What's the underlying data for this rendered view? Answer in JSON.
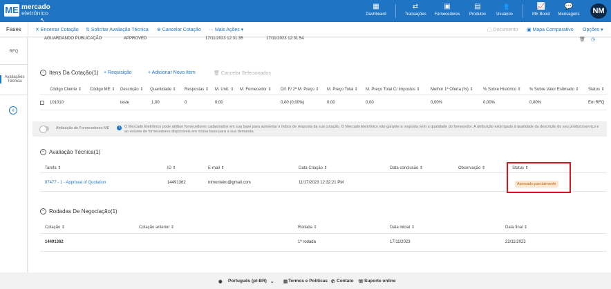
{
  "header": {
    "logo_mark": "ME",
    "logo_line1": "mercado",
    "logo_line2": "eletrônico",
    "nav": [
      {
        "label": "Dashboard",
        "icon": "dashboard-icon",
        "glyph": "▦"
      },
      {
        "label": "Transações",
        "icon": "transactions-icon",
        "glyph": "⇄"
      },
      {
        "label": "Fornecedores",
        "icon": "suppliers-icon",
        "glyph": "▣"
      },
      {
        "label": "Produtos",
        "icon": "products-icon",
        "glyph": "▤"
      },
      {
        "label": "Usuários",
        "icon": "users-icon",
        "glyph": "👥"
      },
      {
        "label": "ME Boost",
        "icon": "boost-icon",
        "glyph": "📈"
      },
      {
        "label": "Mensagens",
        "icon": "messages-icon",
        "glyph": "💬"
      }
    ],
    "avatar": "NM"
  },
  "toolbar": {
    "fases": "Fases",
    "encerrar": "✕ Encerrar Cotação",
    "solicitar": "⇅ Solicitar Avaliação Técnica",
    "cancelar": "⊗ Cancelar Cotação",
    "mais": "··· Mais Ações ▾",
    "documento": "▢ Documento",
    "mapa": "▣ Mapa Comparativo",
    "opcoes": "Opções ▾"
  },
  "rail": {
    "rfq": "RFQ",
    "avaliacoes1": "Avaliações",
    "avaliacoes2": "Técnica",
    "add": "+"
  },
  "top_row": {
    "status": "AGUARDANDO PUBLICAÇÃO",
    "approval": "APPROVED",
    "date1": "17/11/2023 12:31:35",
    "date2": "17/11/2023 12:31:54"
  },
  "itens": {
    "title": "Itens Da Cotação(1)",
    "add_requisicao": "+ Requisição",
    "add_item": "+ Adicionar Novo Item",
    "cancel_selected": "🗑 Cancelar Selecionados",
    "columns": [
      "Código Cliente ⇕",
      "Código ME ⇕",
      "Descrição ⇕",
      "Quantidade ⇕",
      "Respostas ⇕",
      "M. Unit. ⇕",
      "M. Fornecedor ⇕",
      "Dif. F/ 2ª M. Preço ⇕",
      "M. Preço Total ⇕",
      "M. Preço Total C/ Impostos ⇕",
      "Melhor 1ª Oferta (%) ⇕",
      "% Sobre Histórico ⇕",
      "% Sobre Valor Estimado ⇕",
      "Status ⇕"
    ],
    "row": [
      "101010",
      "",
      "teste",
      "1,00",
      "0",
      "0,00",
      "",
      "0,00 (0,00%)",
      "0,00",
      "0,00",
      "0,00%",
      "0,00%",
      "0,00%",
      "Em RFQ"
    ]
  },
  "info": {
    "toggle_label": "Atribuição de Fornecedores ME",
    "text": "O Mercado Eletrônico pode atribuir fornecedores cadastrados em sua base para aumentar o índice de resposta da sua cotação. O Mercado Eletrônico não garante a resposta nem a qualidade do fornecedor. A atribuição está ligada à qualidade da descrição do seu produto/serviço e ao volume de fornecedores disponíveis em nossa base para a sua demanda."
  },
  "avaliacao": {
    "title": "Avaliação Técnica(1)",
    "columns": [
      "Tarefa ⇕",
      "ID ⇕",
      "E-mail ⇕",
      "Data Criação ⇕",
      "Data conclusão ⇕",
      "Observação ⇕",
      "Status ⇕"
    ],
    "row": {
      "tarefa": "87477 - 1 - Approval of Quotation",
      "id": "14491362",
      "email": "ntmonteiro@gmail.com",
      "data_criacao": "11/17/2023 12:32:21 PM",
      "data_conclusao": "",
      "observacao": "",
      "status": "Aprovado parcialmente"
    }
  },
  "rodadas": {
    "title": "Rodadas De Negociação(1)",
    "columns": [
      "Cotação ⇕",
      "Cotação anterior ⇕",
      "Rodada ⇕",
      "Data inicial ⇕",
      "Data final ⇕"
    ],
    "row": [
      "14491362",
      "",
      "1ª rodada",
      "17/11/2023",
      "22/11/2023"
    ]
  },
  "footer": {
    "language": "Português (pt-BR)",
    "terms": "Termos e Políticas",
    "contact": "Contato",
    "support": "Suporte online"
  },
  "colors": {
    "brand": "#1f74c4",
    "highlight": "#d9141a",
    "badge_bg": "#fde6cc"
  }
}
